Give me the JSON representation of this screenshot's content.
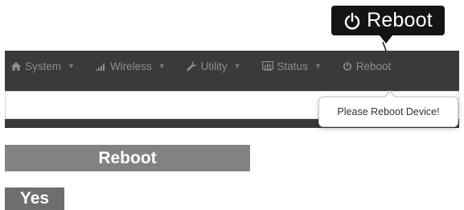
{
  "callout": {
    "label": "Reboot",
    "icon": "power-icon"
  },
  "navbar": {
    "items": [
      {
        "label": "System",
        "icon": "home-icon"
      },
      {
        "label": "Wireless",
        "icon": "signal-bars-icon"
      },
      {
        "label": "Utility",
        "icon": "wrench-icon"
      },
      {
        "label": "Status",
        "icon": "monitor-icon"
      },
      {
        "label": "Reboot",
        "icon": "power-icon"
      }
    ]
  },
  "popover": {
    "text": "Please Reboot Device!"
  },
  "section": {
    "title": "Reboot"
  },
  "actions": {
    "yes_label": "Yes"
  },
  "colors": {
    "navbar_bg": "#3a3a3a",
    "nav_text": "#8d8d8d",
    "callout_bg": "#141414",
    "section_bar_bg": "#828282",
    "button_bg": "#6e6e6e"
  }
}
